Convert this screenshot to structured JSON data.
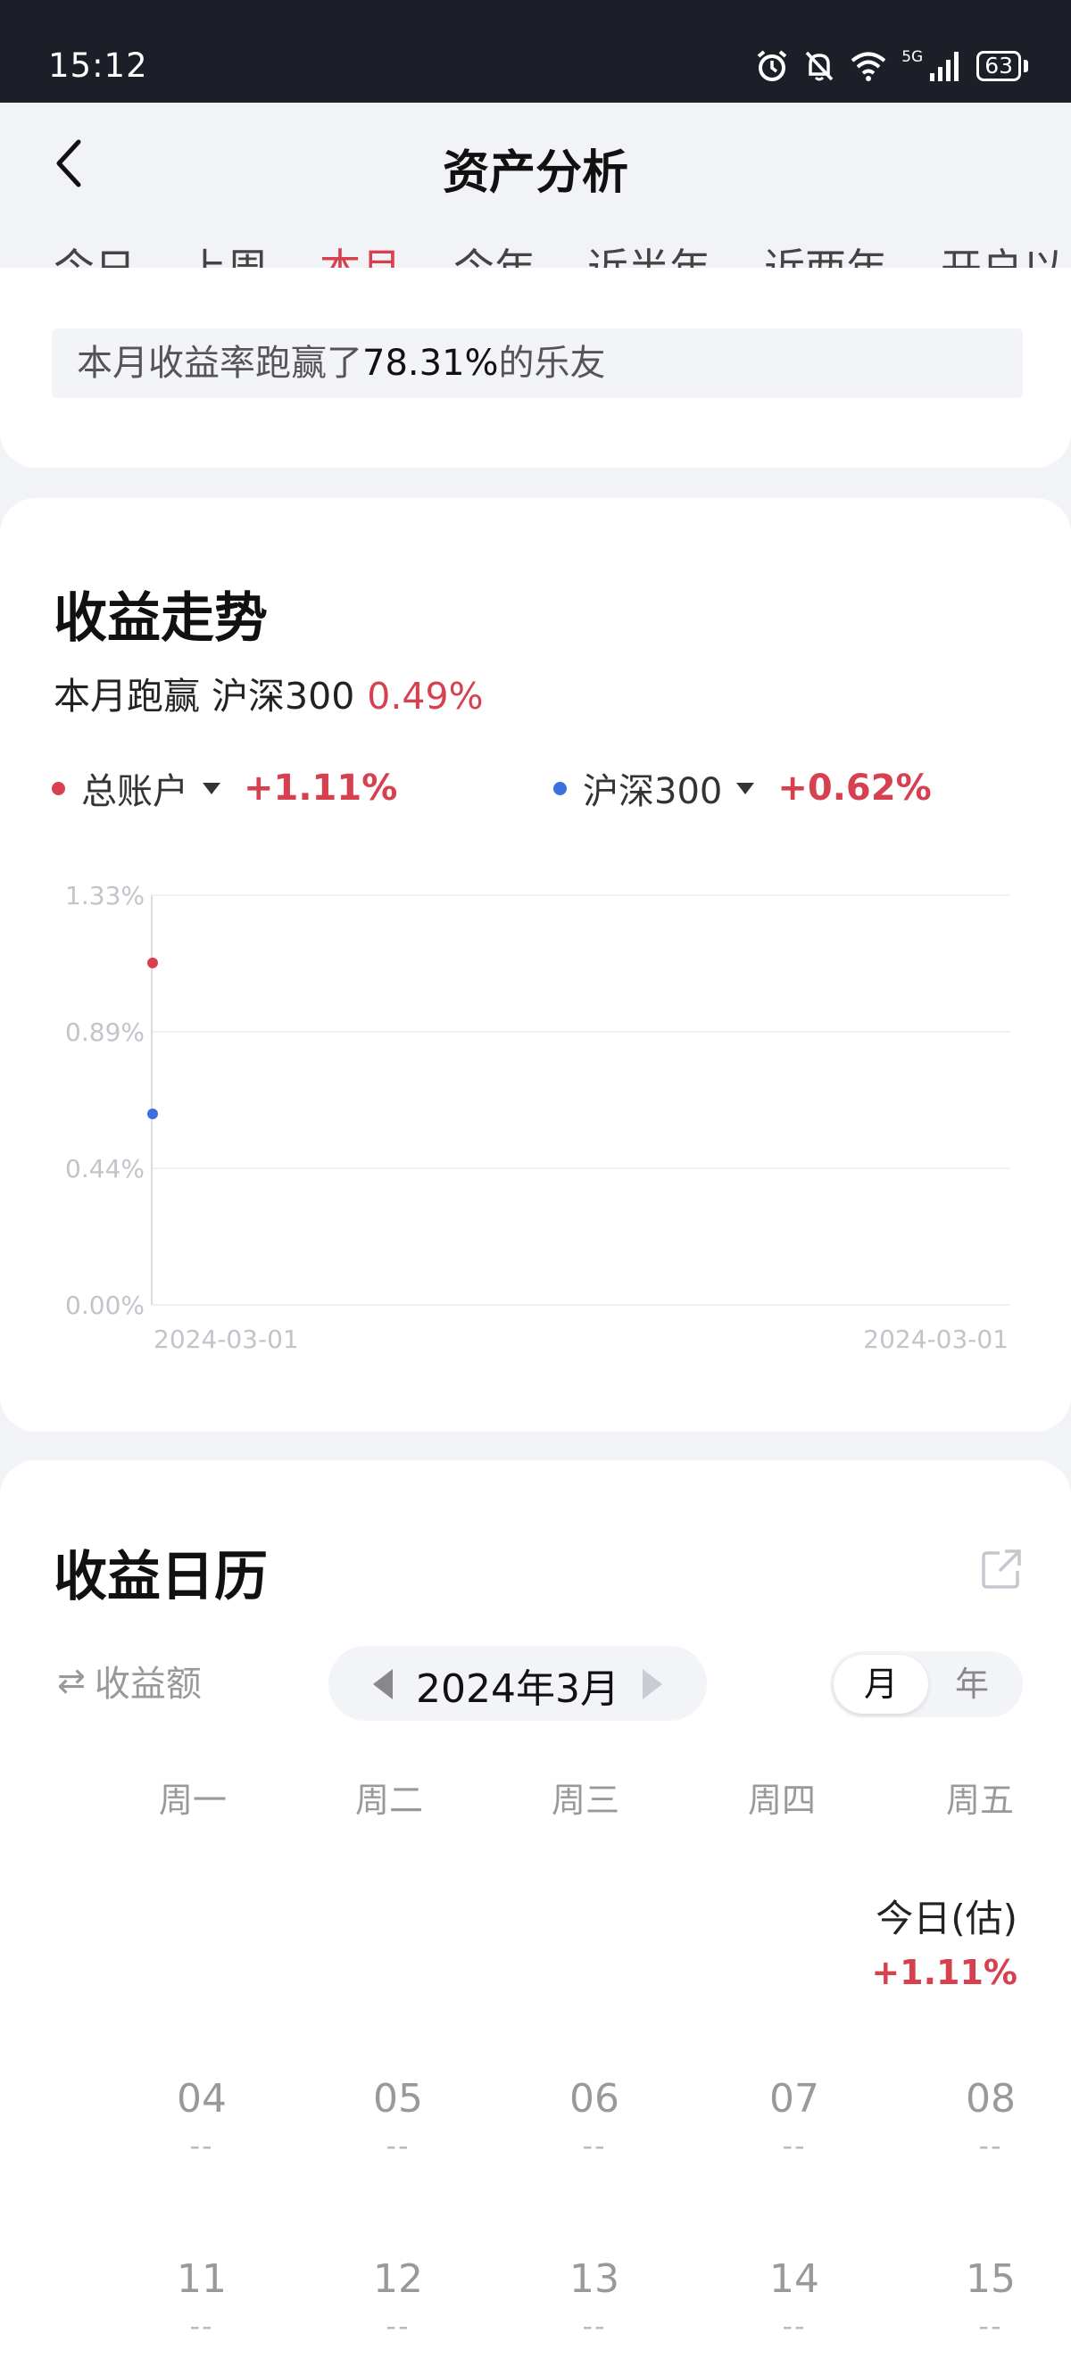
{
  "status_bar": {
    "time": "15:12",
    "network": "5G",
    "battery": "63"
  },
  "header": {
    "title": "资产分析",
    "tabs": [
      {
        "label": "今日",
        "active": false
      },
      {
        "label": "上周",
        "active": false
      },
      {
        "label": "本月",
        "active": true
      },
      {
        "label": "今年",
        "active": false
      },
      {
        "label": "近半年",
        "active": false
      },
      {
        "label": "近两年",
        "active": false
      },
      {
        "label": "开户以",
        "active": false
      }
    ]
  },
  "rank": {
    "prefix": "本月收益率跑赢了",
    "percent": "78.31%",
    "suffix": "的乐友"
  },
  "trend": {
    "title": "收益走势",
    "sub_label": "本月跑赢 沪深300",
    "sub_value": "0.49%",
    "legend": [
      {
        "name": "总账户",
        "value": "+1.11%",
        "color": "#d7414f"
      },
      {
        "name": "沪深300",
        "value": "+0.62%",
        "color": "#3d6fe0"
      }
    ]
  },
  "chart_data": {
    "type": "line",
    "x": [
      "2024-03-01"
    ],
    "x_tick_labels": [
      "2024-03-01",
      "2024-03-01"
    ],
    "y_tick_labels": [
      "1.33%",
      "0.89%",
      "0.44%",
      "0.00%"
    ],
    "ylim": [
      0,
      1.33
    ],
    "series": [
      {
        "name": "总账户",
        "values": [
          1.11
        ],
        "color": "#d7414f"
      },
      {
        "name": "沪深300",
        "values": [
          0.62
        ],
        "color": "#3d6fe0"
      }
    ]
  },
  "calendar": {
    "title": "收益日历",
    "metric_label": "收益额",
    "month_label": "2024年3月",
    "period_options": [
      "月",
      "年"
    ],
    "weekdays": [
      "周一",
      "周二",
      "周三",
      "周四",
      "周五"
    ],
    "today_label": "今日(估)",
    "today_value": "+1.11%",
    "weeks": [
      [
        {
          "day": "04",
          "value": "--"
        },
        {
          "day": "05",
          "value": "--"
        },
        {
          "day": "06",
          "value": "--"
        },
        {
          "day": "07",
          "value": "--"
        },
        {
          "day": "08",
          "value": "--"
        }
      ],
      [
        {
          "day": "11",
          "value": "--"
        },
        {
          "day": "12",
          "value": "--"
        },
        {
          "day": "13",
          "value": "--"
        },
        {
          "day": "14",
          "value": "--"
        },
        {
          "day": "15",
          "value": "--"
        }
      ]
    ]
  }
}
